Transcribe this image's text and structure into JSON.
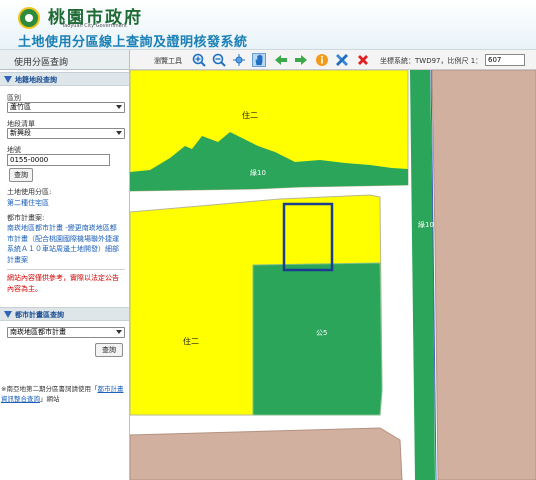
{
  "header": {
    "gov_name": "桃園市政府",
    "gov_name_en": "Taoyuan City Government",
    "system_title": "土地使用分區線上查詢及證明核發系統"
  },
  "side_tab": {
    "label": "使用分區查詢"
  },
  "toolbar": {
    "label": "瀏覽工具",
    "tools": [
      "zoom-in-icon",
      "zoom-out-icon",
      "full-extent-icon",
      "pan-hand-icon",
      "previous-extent-icon",
      "next-extent-icon",
      "info-icon",
      "measure-icon",
      "clear-icon"
    ],
    "coord_text": "坐標系統：TWD97，比例尺 1：",
    "scale_value": "607"
  },
  "land_query": {
    "header": "地籍地段查詢",
    "district_label": "區別",
    "district_value": "蘆竹區",
    "section_label": "地段清單",
    "section_value": "新興段",
    "lot_label": "地號",
    "lot_value": "0155-0000",
    "query_button": "查詢",
    "zoning_label": "土地使用分區:",
    "zoning_value": "第二種住宅區",
    "plan_label": "都市計畫案:",
    "plan_value": "南崁地區都市計畫 -變更南崁地區都市計畫（配合桃園國際機場聯外捷運系統Ａ１０車站周邊土地開發）細部計畫案",
    "warning": "網站內容僅供參考，實際以法定公告內容為主。"
  },
  "plan_query": {
    "header": "都市計畫區查詢",
    "plan_select": "南崁地區都市計畫",
    "query_button": "查詢"
  },
  "footer_note": {
    "prefix": "※南亞地第二期分區書詞請使用「",
    "link_text": "都市計畫資訊整合查詢",
    "suffix": "」網站"
  },
  "map": {
    "labels": {
      "zone_res_top": "住二",
      "zone_green_top": "綠10",
      "zone_green_right": "綠10",
      "zone_park": "公5",
      "zone_res_bottom": "住二"
    },
    "colors": {
      "residential": "#ffff00",
      "green": "#2aa55a",
      "road": "#ffffff",
      "other": "#d2b0a0",
      "selected_parcel": "#1a3d8f"
    }
  }
}
